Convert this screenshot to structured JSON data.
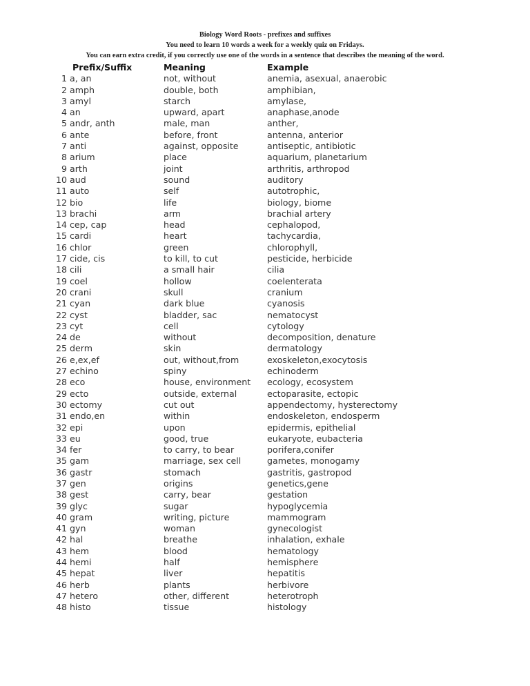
{
  "header": {
    "title": "Biology Word Roots - prefixes and suffixes",
    "line2": "You need to learn 10 words a week for a weekly quiz on Fridays.",
    "line3": "You can earn extra credit, if you correctly use one of the words in a sentence  that  describes the meaning of the word."
  },
  "columns": {
    "prefix": "Prefix/Suffix",
    "meaning": "Meaning",
    "example": "Example"
  },
  "rows": [
    {
      "num": "1",
      "prefix": "a, an",
      "meaning": "not, without",
      "example": "anemia, asexual, anaerobic"
    },
    {
      "num": "2",
      "prefix": "amph",
      "meaning": "double, both",
      "example": "amphibian,"
    },
    {
      "num": "3",
      "prefix": "amyl",
      "meaning": "starch",
      "example": "amylase,"
    },
    {
      "num": "4",
      "prefix": "an",
      "meaning": "upward, apart",
      "example": "anaphase,anode"
    },
    {
      "num": "5",
      "prefix": "andr, anth",
      "meaning": "male, man",
      "example": "anther,"
    },
    {
      "num": "6",
      "prefix": "ante",
      "meaning": "before, front",
      "example": "antenna, anterior"
    },
    {
      "num": "7",
      "prefix": "anti",
      "meaning": "against, opposite",
      "example": "antiseptic, antibiotic"
    },
    {
      "num": "8",
      "prefix": "arium",
      "meaning": "place",
      "example": "aquarium, planetarium"
    },
    {
      "num": "9",
      "prefix": "arth",
      "meaning": "joint",
      "example": "arthritis, arthropod"
    },
    {
      "num": "10",
      "prefix": "aud",
      "meaning": "sound",
      "example": "auditory"
    },
    {
      "num": "11",
      "prefix": "auto",
      "meaning": "self",
      "example": "autotrophic,"
    },
    {
      "num": "12",
      "prefix": "bio",
      "meaning": "life",
      "example": "biology, biome"
    },
    {
      "num": "13",
      "prefix": "brachi",
      "meaning": "arm",
      "example": "brachial artery"
    },
    {
      "num": "14",
      "prefix": "cep, cap",
      "meaning": "head",
      "example": "cephalopod,"
    },
    {
      "num": "15",
      "prefix": "cardi",
      "meaning": "heart",
      "example": "tachycardia,"
    },
    {
      "num": "16",
      "prefix": "chlor",
      "meaning": "green",
      "example": "chlorophyll,"
    },
    {
      "num": "17",
      "prefix": "cide, cis",
      "meaning": "to kill, to cut",
      "example": "pesticide, herbicide"
    },
    {
      "num": "18",
      "prefix": "cili",
      "meaning": "a small hair",
      "example": "cilia"
    },
    {
      "num": "19",
      "prefix": "coel",
      "meaning": "hollow",
      "example": "coelenterata"
    },
    {
      "num": "20",
      "prefix": "crani",
      "meaning": "skull",
      "example": "cranium"
    },
    {
      "num": "21",
      "prefix": "cyan",
      "meaning": "dark blue",
      "example": "cyanosis"
    },
    {
      "num": "22",
      "prefix": "cyst",
      "meaning": "bladder, sac",
      "example": "nematocyst"
    },
    {
      "num": "23",
      "prefix": "cyt",
      "meaning": "cell",
      "example": "cytology"
    },
    {
      "num": "24",
      "prefix": "de",
      "meaning": "without",
      "example": "decomposition, denature"
    },
    {
      "num": "25",
      "prefix": "derm",
      "meaning": "skin",
      "example": "dermatology"
    },
    {
      "num": "26",
      "prefix": "e,ex,ef",
      "meaning": "out, without,from",
      "example": "exoskeleton,exocytosis"
    },
    {
      "num": "27",
      "prefix": "echino",
      "meaning": "spiny",
      "example": "echinoderm"
    },
    {
      "num": "28",
      "prefix": "eco",
      "meaning": "house, environment",
      "example": "ecology, ecosystem"
    },
    {
      "num": "29",
      "prefix": "ecto",
      "meaning": "outside, external",
      "example": "ectoparasite, ectopic"
    },
    {
      "num": "30",
      "prefix": "ectomy",
      "meaning": "cut out",
      "example": "appendectomy, hysterectomy"
    },
    {
      "num": "31",
      "prefix": "endo,en",
      "meaning": "within",
      "example": "endoskeleton, endosperm"
    },
    {
      "num": "32",
      "prefix": "epi",
      "meaning": "upon",
      "example": "epidermis, epithelial"
    },
    {
      "num": "33",
      "prefix": "eu",
      "meaning": "good, true",
      "example": "eukaryote, eubacteria"
    },
    {
      "num": "34",
      "prefix": "fer",
      "meaning": "to carry, to bear",
      "example": "porifera,conifer"
    },
    {
      "num": "35",
      "prefix": "gam",
      "meaning": "marriage, sex cell",
      "example": "gametes, monogamy"
    },
    {
      "num": "36",
      "prefix": "gastr",
      "meaning": "stomach",
      "example": "gastritis, gastropod"
    },
    {
      "num": "37",
      "prefix": "gen",
      "meaning": "origins",
      "example": "genetics,gene"
    },
    {
      "num": "38",
      "prefix": "gest",
      "meaning": "carry, bear",
      "example": "gestation"
    },
    {
      "num": "39",
      "prefix": "glyc",
      "meaning": "sugar",
      "example": "hypoglycemia"
    },
    {
      "num": "40",
      "prefix": "gram",
      "meaning": "writing, picture",
      "example": "mammogram"
    },
    {
      "num": "41",
      "prefix": "gyn",
      "meaning": "woman",
      "example": "gynecologist"
    },
    {
      "num": "42",
      "prefix": "hal",
      "meaning": "breathe",
      "example": "inhalation, exhale"
    },
    {
      "num": "43",
      "prefix": "hem",
      "meaning": "blood",
      "example": "hematology"
    },
    {
      "num": "44",
      "prefix": "hemi",
      "meaning": "half",
      "example": "hemisphere"
    },
    {
      "num": "45",
      "prefix": "hepat",
      "meaning": "liver",
      "example": "hepatitis"
    },
    {
      "num": "46",
      "prefix": "herb",
      "meaning": "plants",
      "example": "herbivore"
    },
    {
      "num": "47",
      "prefix": "hetero",
      "meaning": "other, different",
      "example": "heterotroph"
    },
    {
      "num": "48",
      "prefix": "histo",
      "meaning": "tissue",
      "example": "histology"
    }
  ]
}
